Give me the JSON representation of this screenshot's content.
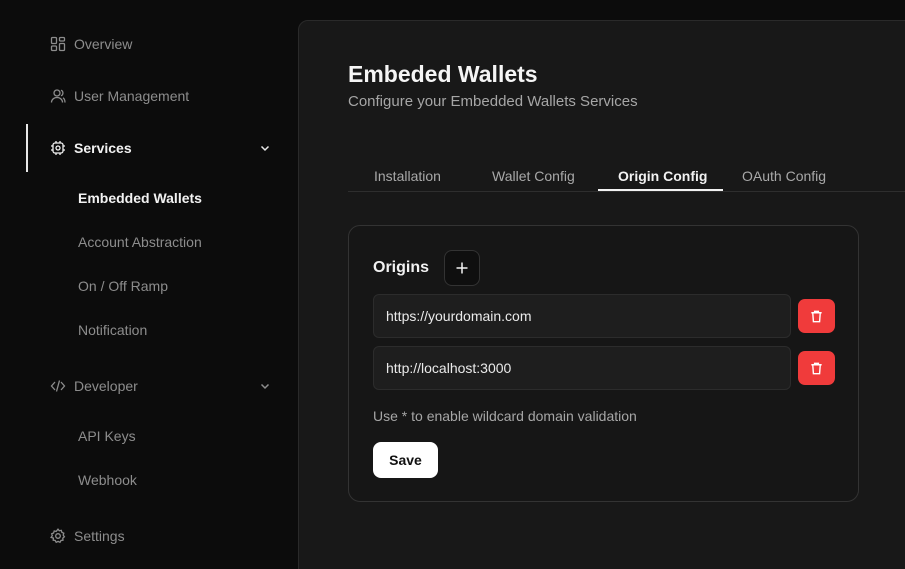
{
  "sidebar": {
    "items": [
      {
        "label": "Overview",
        "icon": "grid-icon"
      },
      {
        "label": "User Management",
        "icon": "user-icon"
      },
      {
        "label": "Services",
        "icon": "chip-icon"
      },
      {
        "label": "Developer",
        "icon": "code-icon"
      },
      {
        "label": "Settings",
        "icon": "gear-icon"
      }
    ],
    "services_sub": [
      "Embedded Wallets",
      "Account Abstraction",
      "On / Off Ramp",
      "Notification"
    ],
    "developer_sub": [
      "API Keys",
      "Webhook"
    ]
  },
  "main": {
    "title": "Embeded Wallets",
    "subtitle": "Configure your Embedded Wallets Services",
    "tabs": [
      "Installation",
      "Wallet Config",
      "Origin Config",
      "OAuth Config"
    ],
    "active_tab": "Origin Config",
    "card": {
      "origins_label": "Origins",
      "origins": [
        "https://yourdomain.com",
        "http://localhost:3000"
      ],
      "hint": "Use * to enable wildcard domain validation",
      "save_label": "Save"
    }
  },
  "colors": {
    "background": "#0c0c0c",
    "panel": "#181818",
    "delete": "#f03b3b",
    "save": "#ffffff"
  }
}
